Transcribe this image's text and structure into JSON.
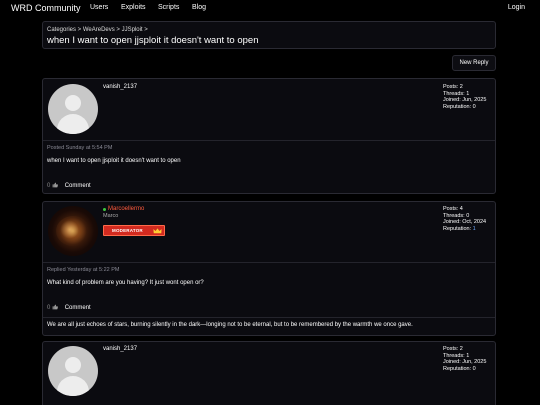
{
  "nav": {
    "brand": "WRD Community",
    "links": [
      "Users",
      "Exploits",
      "Scripts",
      "Blog"
    ],
    "login": "Login"
  },
  "thread": {
    "breadcrumb": "Categories > WeAreDevs > JJSploit >",
    "title": "when I want to open jjsploit it doesn't want to open",
    "new_reply": "New Reply"
  },
  "posts": [
    {
      "username": "vanish_2137",
      "stats": {
        "posts": "Posts: 2",
        "threads": "Threads: 1",
        "joined": "Joined: Jun, 2025",
        "reputation": "Reputation: 0"
      },
      "meta": "Posted Sunday at 5:54 PM",
      "content": "when I want to open jjsploit it doesn't want to open",
      "like_count": "0",
      "comment": "Comment"
    },
    {
      "username": "Marcoellermo",
      "subname": "Marco",
      "badge": "MODERATOR",
      "stats": {
        "posts": "Posts: 4",
        "threads": "Threads: 0",
        "joined": "Joined: Oct, 2024",
        "reputation_label": "Reputation: ",
        "reputation_value": "1"
      },
      "meta": "Replied Yesterday at 5:22 PM",
      "content": "What kind of problem are you having? It just wont open or?",
      "like_count": "0",
      "comment": "Comment",
      "signature": "We are all just echoes of stars, burning silently in the dark—longing not to be eternal, but to be remembered by the warmth we once gave."
    },
    {
      "username": "vanish_2137",
      "stats": {
        "posts": "Posts: 2",
        "threads": "Threads: 1",
        "joined": "Joined: Jun, 2025",
        "reputation": "Reputation: 0"
      }
    }
  ],
  "colors": {
    "background": "#000000",
    "panel": "#0b0b10",
    "border": "#2a2a33",
    "moderator_name": "#ff5a3c",
    "moderator_badge": "#d22a1f",
    "online": "#3ec83e",
    "reputation_positive": "#6aa8ff"
  },
  "icons": {
    "like": "thumbs-up-icon",
    "crown": "crown-icon",
    "avatar_default": "default-avatar-icon",
    "online": "online-dot-icon"
  }
}
